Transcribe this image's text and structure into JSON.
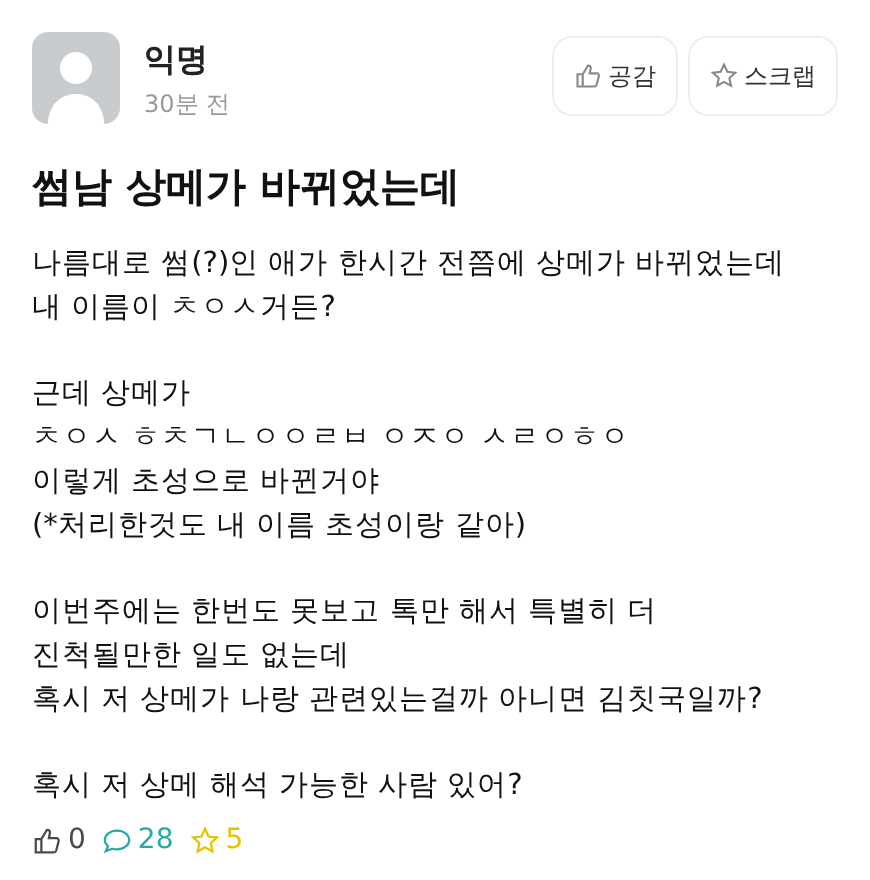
{
  "author": {
    "name": "익명",
    "time": "30분 전"
  },
  "actions": [
    {
      "kind": "like",
      "label": "공감"
    },
    {
      "kind": "scrap",
      "label": "스크랩"
    }
  ],
  "title": "썸남 상메가 바뀌었는데",
  "paragraphs": [
    "나름대로 썸(?)인 애가 한시간 전쯤에 상메가 바뀌었는데\n내 이름이 ㅊㅇㅅ거든?",
    "근데 상메가\nㅊㅇㅅ ㅎㅊㄱㄴㅇㅇㄹㅂ ㅇㅈㅇ ㅅㄹㅇㅎㅇ\n이렇게 초성으로 바뀐거야\n(*처리한것도 내 이름 초성이랑 같아)",
    "이번주에는 한번도 못보고 톡만 해서 특별히 더\n진척될만한 일도 없는데\n혹시 저 상메가 나랑 관련있는걸까 아니면 김칫국일까?",
    "혹시 저 상메 해석 가능한 사람 있어?"
  ],
  "stats": [
    {
      "kind": "like",
      "count": "0",
      "color": "#4a4a4a"
    },
    {
      "kind": "comment",
      "count": "28",
      "color": "#2aa8a8"
    },
    {
      "kind": "scrap",
      "count": "5",
      "color": "#e0c400"
    }
  ]
}
